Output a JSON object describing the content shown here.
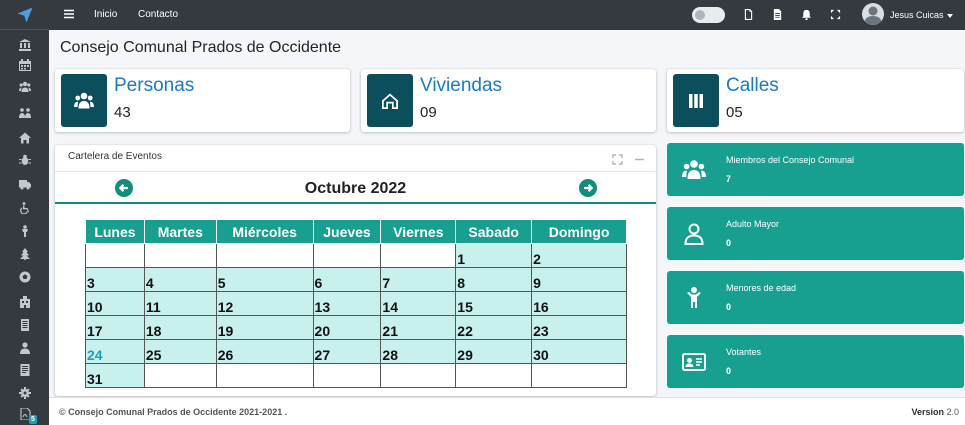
{
  "navbar": {
    "links": [
      "Inicio",
      "Contacto"
    ],
    "user_name": "Jesus Cuicas"
  },
  "sidebar": {
    "icons": [
      "logo-icon",
      "bank-icon",
      "calendar-icon",
      "users-icon",
      "people-arrows-icon",
      "home-icon",
      "bug-icon",
      "ambulance-icon",
      "wheelchair-icon",
      "child-icon",
      "tree-icon",
      "soccer-icon",
      "building-icon",
      "document-icon",
      "user-icon",
      "report-icon",
      "cog-icon",
      "pdf-icon"
    ],
    "pdf_badge": "5"
  },
  "page": {
    "title": "Consejo Comunal Prados de Occidente"
  },
  "info_boxes": [
    {
      "title": "Personas",
      "value": "43",
      "icon": "users-icon"
    },
    {
      "title": "Viviendas",
      "value": "09",
      "icon": "house-icon"
    },
    {
      "title": "Calles",
      "value": "05",
      "icon": "columns-icon"
    }
  ],
  "calendar": {
    "card_title": "Cartelera de Eventos",
    "month_label": "Octubre 2022",
    "weekdays": [
      "Lunes",
      "Martes",
      "Miércoles",
      "Jueves",
      "Viernes",
      "Sabado",
      "Domingo"
    ],
    "today": "24",
    "weeks": [
      [
        "",
        "",
        "",
        "",
        "",
        "1",
        "2"
      ],
      [
        "3",
        "4",
        "5",
        "6",
        "7",
        "8",
        "9"
      ],
      [
        "10",
        "11",
        "12",
        "13",
        "14",
        "15",
        "16"
      ],
      [
        "17",
        "18",
        "19",
        "20",
        "21",
        "22",
        "23"
      ],
      [
        "24",
        "25",
        "26",
        "27",
        "28",
        "29",
        "30"
      ],
      [
        "31",
        "",
        "",
        "",
        "",
        "",
        ""
      ]
    ]
  },
  "stats": [
    {
      "label": "Miembros del Consejo Comunal",
      "value": "7",
      "icon": "users-icon"
    },
    {
      "label": "Adulto Mayor",
      "value": "0",
      "icon": "user-icon"
    },
    {
      "label": "Menores de edad",
      "value": "0",
      "icon": "child-icon"
    },
    {
      "label": "Votantes",
      "value": "0",
      "icon": "id-card-icon"
    }
  ],
  "footer": {
    "copyright": "© Consejo Comunal Prados de Occidente 2021-2021 .",
    "version_label": "Version",
    "version_value": "2.0"
  },
  "colors": {
    "sidebar": "#343a40",
    "accent_teal": "#17a08f",
    "dark_teal": "#0b4f5c",
    "link_blue": "#1a7acb",
    "cell_bg": "#c8f1ed"
  }
}
